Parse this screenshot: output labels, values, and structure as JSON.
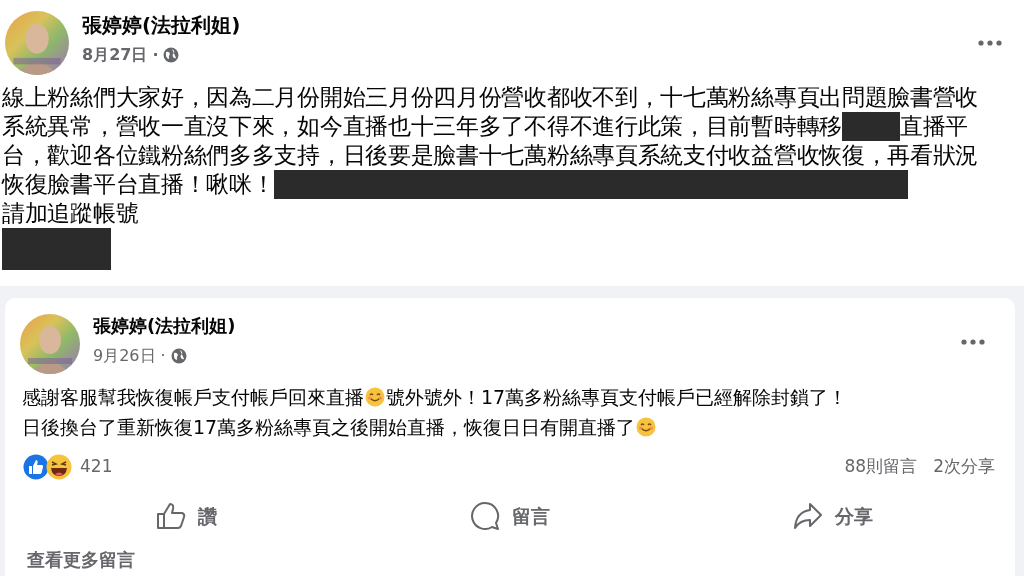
{
  "post_1": {
    "author": "張婷婷(法拉利姐)",
    "date": "8月27日",
    "separator": "·",
    "body_lines": [
      [
        {
          "kind": "text",
          "text": "線上粉絲們大家好，因為二月份開始三月份四月份營收都收不到，十七萬粉絲專頁出問題臉書營收"
        }
      ],
      [
        {
          "kind": "text",
          "text": "系統異常，營收一直沒下來，如今直播也十三年多了不得不進行此策，目前暫時轉移"
        },
        {
          "kind": "redacted"
        },
        {
          "kind": "text",
          "text": "直播平"
        }
      ],
      [
        {
          "kind": "text",
          "text": "台，歡迎各位鐵粉絲們多多支持，日後要是臉書十七萬粉絲專頁系統支付收益營收恢復，再看狀況"
        }
      ],
      [
        {
          "kind": "text",
          "text": "恢復臉書平台直播！啾咪！"
        },
        {
          "kind": "redacted"
        }
      ],
      [
        {
          "kind": "text",
          "text": "請加追蹤帳號"
        }
      ],
      [
        {
          "kind": "redacted"
        }
      ]
    ]
  },
  "post_2": {
    "author": "張婷婷(法拉利姐)",
    "date": "9月26日",
    "separator": "·",
    "body_lines": [
      [
        {
          "kind": "text",
          "text": "感謝客服幫我恢復帳戶支付帳戶回來直播"
        },
        {
          "kind": "emoji"
        },
        {
          "kind": "text",
          "text": "號外號外！17萬多粉絲專頁支付帳戶已經解除封鎖了！"
        }
      ],
      [
        {
          "kind": "text",
          "text": "日後換台了重新恢復17萬多粉絲專頁之後開始直播，恢復日日有開直播了"
        },
        {
          "kind": "emoji"
        }
      ]
    ],
    "reaction_count": "421",
    "comments": "88則留言",
    "shares": "2次分享",
    "actions": [
      {
        "kind": "like",
        "label": "讚"
      },
      {
        "kind": "comment",
        "label": "留言"
      },
      {
        "kind": "share",
        "label": "分享"
      }
    ],
    "more_comments": "查看更多留言"
  }
}
